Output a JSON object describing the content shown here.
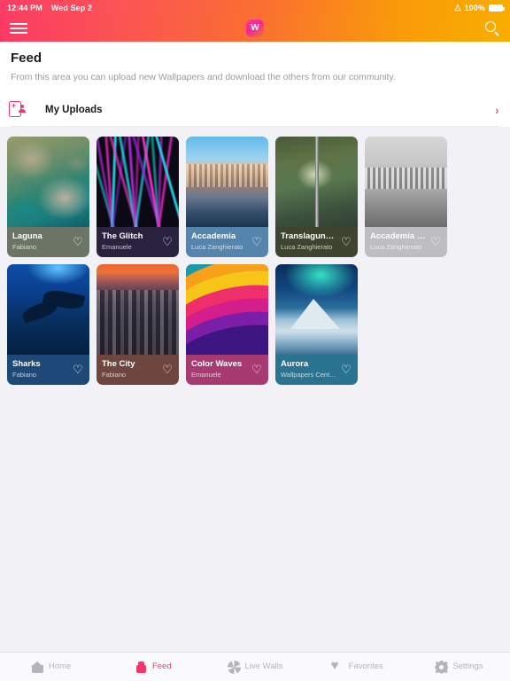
{
  "statusbar": {
    "time": "12:44 PM",
    "date": "Wed Sep 2",
    "wifi_icon": "wifi-icon",
    "battery_level": "100%",
    "battery_icon": "battery-full-icon"
  },
  "navbar": {
    "menu_icon": "hamburger-menu-icon",
    "logo_letter": "W",
    "logo_icon": "app-logo-icon",
    "search_icon": "search-icon"
  },
  "header": {
    "title": "Feed",
    "subtitle": "From this area you can upload new Wallpapers and download the others from our community.",
    "uploads_label": "My Uploads",
    "uploads_icon": "add-person-icon",
    "chevron": "›",
    "accent_color": "#f0396b"
  },
  "grid": {
    "heart_glyph": "♡",
    "cards": [
      {
        "title": "Laguna",
        "author": "Fabiano",
        "caption_color": "#6c7466",
        "thumb": "th-laguna"
      },
      {
        "title": "The Glitch",
        "author": "Emanuele",
        "caption_color": "#2a2340",
        "thumb": "th-glitch"
      },
      {
        "title": "Accademia",
        "author": "Luca Zanghierato",
        "caption_color": "#5584ac",
        "thumb": "th-acc"
      },
      {
        "title": "Translagunare",
        "author": "Luca Zanghierato",
        "caption_color": "#3d4430",
        "thumb": "th-trans"
      },
      {
        "title": "Accademia Bl...",
        "author": "Luca Zanghierato",
        "caption_color": "#bebec1",
        "thumb": "th-accbl"
      },
      {
        "title": "Sharks",
        "author": "Fabiano",
        "caption_color": "#1d4878",
        "thumb": "th-sharks"
      },
      {
        "title": "The City",
        "author": "Fabiano",
        "caption_color": "#6e463f",
        "thumb": "th-city"
      },
      {
        "title": "Color Waves",
        "author": "Emanuele",
        "caption_color": "#a83a72",
        "thumb": "th-waves"
      },
      {
        "title": "Aurora",
        "author": "Wallpapers Central",
        "caption_color": "#2a7391",
        "thumb": "th-aurora"
      }
    ]
  },
  "tabbar": {
    "active_index": 1,
    "tabs": [
      {
        "label": "Home",
        "icon": "home-icon"
      },
      {
        "label": "Feed",
        "icon": "feed-icon"
      },
      {
        "label": "Live Walls",
        "icon": "live-walls-icon"
      },
      {
        "label": "Favorites",
        "icon": "favorites-heart-icon"
      },
      {
        "label": "Settings",
        "icon": "settings-gear-icon"
      }
    ]
  }
}
